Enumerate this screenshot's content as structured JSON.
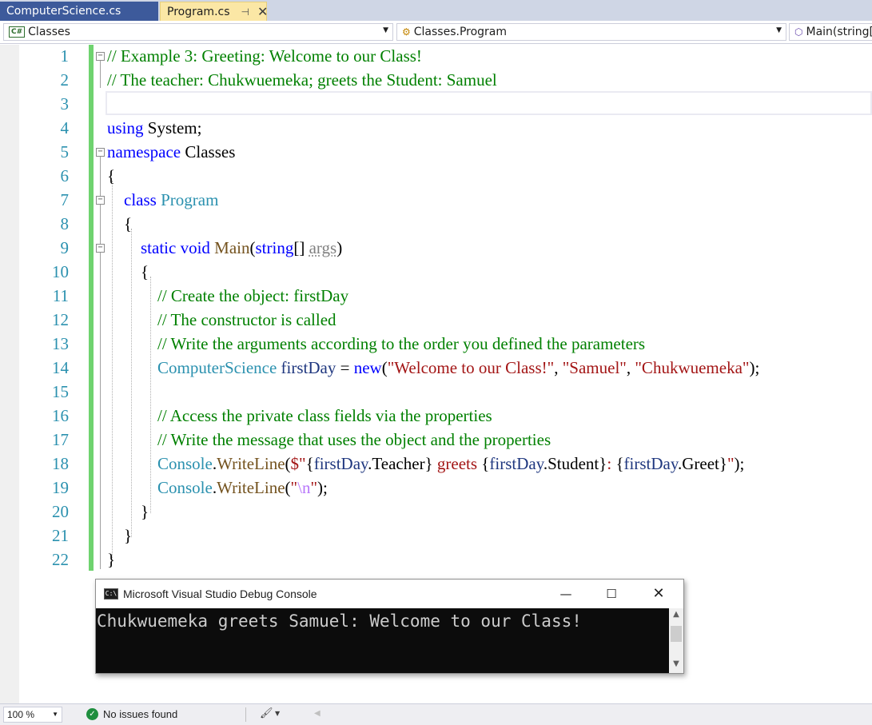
{
  "tabs": [
    {
      "label": "ComputerScience.cs",
      "active": false
    },
    {
      "label": "Program.cs",
      "active": true,
      "pin": "⊣",
      "close": "✕"
    }
  ],
  "navbar": {
    "project_badge": "C#",
    "project": "Classes",
    "type": "Classes.Program",
    "member": "Main(string[] args)"
  },
  "code_lines": [
    {
      "num": "1",
      "segments": [
        [
          "cm",
          "// Example 3: Greeting: Welcome to our Class!"
        ]
      ]
    },
    {
      "num": "2",
      "segments": [
        [
          "cm",
          "// The teacher: Chukwuemeka; greets the Student: Samuel"
        ]
      ]
    },
    {
      "num": "3",
      "segments": []
    },
    {
      "num": "4",
      "segments": [
        [
          "kw",
          "using"
        ],
        [
          "pl",
          " System;"
        ]
      ]
    },
    {
      "num": "5",
      "segments": [
        [
          "kw",
          "namespace"
        ],
        [
          "pl",
          " Classes"
        ]
      ]
    },
    {
      "num": "6",
      "segments": [
        [
          "pl",
          "{"
        ]
      ]
    },
    {
      "num": "7",
      "segments": [
        [
          "pl",
          "    "
        ],
        [
          "kw",
          "class"
        ],
        [
          "pl",
          " "
        ],
        [
          "ty",
          "Program"
        ]
      ]
    },
    {
      "num": "8",
      "segments": [
        [
          "pl",
          "    {"
        ]
      ]
    },
    {
      "num": "9",
      "segments": [
        [
          "pl",
          "        "
        ],
        [
          "kw",
          "static"
        ],
        [
          "pl",
          " "
        ],
        [
          "kw",
          "void"
        ],
        [
          "pl",
          " "
        ],
        [
          "mt",
          "Main"
        ],
        [
          "pl",
          "("
        ],
        [
          "kw",
          "string"
        ],
        [
          "pl",
          "[] "
        ],
        [
          "pa",
          "args"
        ],
        [
          "pl",
          ")"
        ]
      ]
    },
    {
      "num": "10",
      "segments": [
        [
          "pl",
          "        {"
        ]
      ]
    },
    {
      "num": "11",
      "segments": [
        [
          "pl",
          "            "
        ],
        [
          "cm",
          "// Create the object: firstDay"
        ]
      ]
    },
    {
      "num": "12",
      "segments": [
        [
          "pl",
          "            "
        ],
        [
          "cm",
          "// The constructor is called"
        ]
      ]
    },
    {
      "num": "13",
      "segments": [
        [
          "pl",
          "            "
        ],
        [
          "cm",
          "// Write the arguments according to the order you defined the parameters"
        ]
      ]
    },
    {
      "num": "14",
      "segments": [
        [
          "pl",
          "            "
        ],
        [
          "ty",
          "ComputerScience"
        ],
        [
          "pl",
          " "
        ],
        [
          "lv",
          "firstDay"
        ],
        [
          "pl",
          " = "
        ],
        [
          "kw",
          "new"
        ],
        [
          "pl",
          "("
        ],
        [
          "st",
          "\"Welcome to our Class!\""
        ],
        [
          "pl",
          ", "
        ],
        [
          "st",
          "\"Samuel\""
        ],
        [
          "pl",
          ", "
        ],
        [
          "st",
          "\"Chukwuemeka\""
        ],
        [
          "pl",
          ");"
        ]
      ]
    },
    {
      "num": "15",
      "segments": []
    },
    {
      "num": "16",
      "segments": [
        [
          "pl",
          "            "
        ],
        [
          "cm",
          "// Access the private class fields via the properties"
        ]
      ]
    },
    {
      "num": "17",
      "segments": [
        [
          "pl",
          "            "
        ],
        [
          "cm",
          "// Write the message that uses the object and the properties"
        ]
      ]
    },
    {
      "num": "18",
      "segments": [
        [
          "pl",
          "            "
        ],
        [
          "ty",
          "Console"
        ],
        [
          "pl",
          "."
        ],
        [
          "mt",
          "WriteLine"
        ],
        [
          "pl",
          "("
        ],
        [
          "st",
          "$\""
        ],
        [
          "pl",
          "{"
        ],
        [
          "lv",
          "firstDay"
        ],
        [
          "pl",
          ".Teacher} "
        ],
        [
          "st",
          "greets"
        ],
        [
          "pl",
          " {"
        ],
        [
          "lv",
          "firstDay"
        ],
        [
          "pl",
          ".Student}"
        ],
        [
          "st",
          ": "
        ],
        [
          "pl",
          "{"
        ],
        [
          "lv",
          "firstDay"
        ],
        [
          "pl",
          ".Greet}"
        ],
        [
          "st",
          "\""
        ],
        [
          "pl",
          ");"
        ]
      ]
    },
    {
      "num": "19",
      "segments": [
        [
          "pl",
          "            "
        ],
        [
          "ty",
          "Console"
        ],
        [
          "pl",
          "."
        ],
        [
          "mt",
          "WriteLine"
        ],
        [
          "pl",
          "("
        ],
        [
          "st",
          "\""
        ],
        [
          "es",
          "\\n"
        ],
        [
          "st",
          "\""
        ],
        [
          "pl",
          ");"
        ]
      ]
    },
    {
      "num": "20",
      "segments": [
        [
          "pl",
          "        }"
        ]
      ]
    },
    {
      "num": "21",
      "segments": [
        [
          "pl",
          "    }"
        ]
      ]
    },
    {
      "num": "22",
      "segments": [
        [
          "pl",
          "}"
        ]
      ]
    }
  ],
  "collapsible_lines": [
    "1",
    "5",
    "7",
    "9"
  ],
  "console": {
    "title": "Microsoft Visual Studio Debug Console",
    "icon_label": "C:\\",
    "output": "Chukwuemeka greets Samuel: Welcome to our Class!",
    "minimize": "—",
    "maximize": "☐",
    "close": "✕"
  },
  "statusbar": {
    "zoom": "100 %",
    "issues": "No issues found"
  },
  "colors": {
    "keyword": "#0000ff",
    "comment": "#008000",
    "type": "#2b91af",
    "string": "#a31515",
    "method": "#74531f",
    "tab_inactive": "#3d5a9b",
    "tab_active": "#fbe7a5",
    "change_bar": "#6fd36f"
  }
}
